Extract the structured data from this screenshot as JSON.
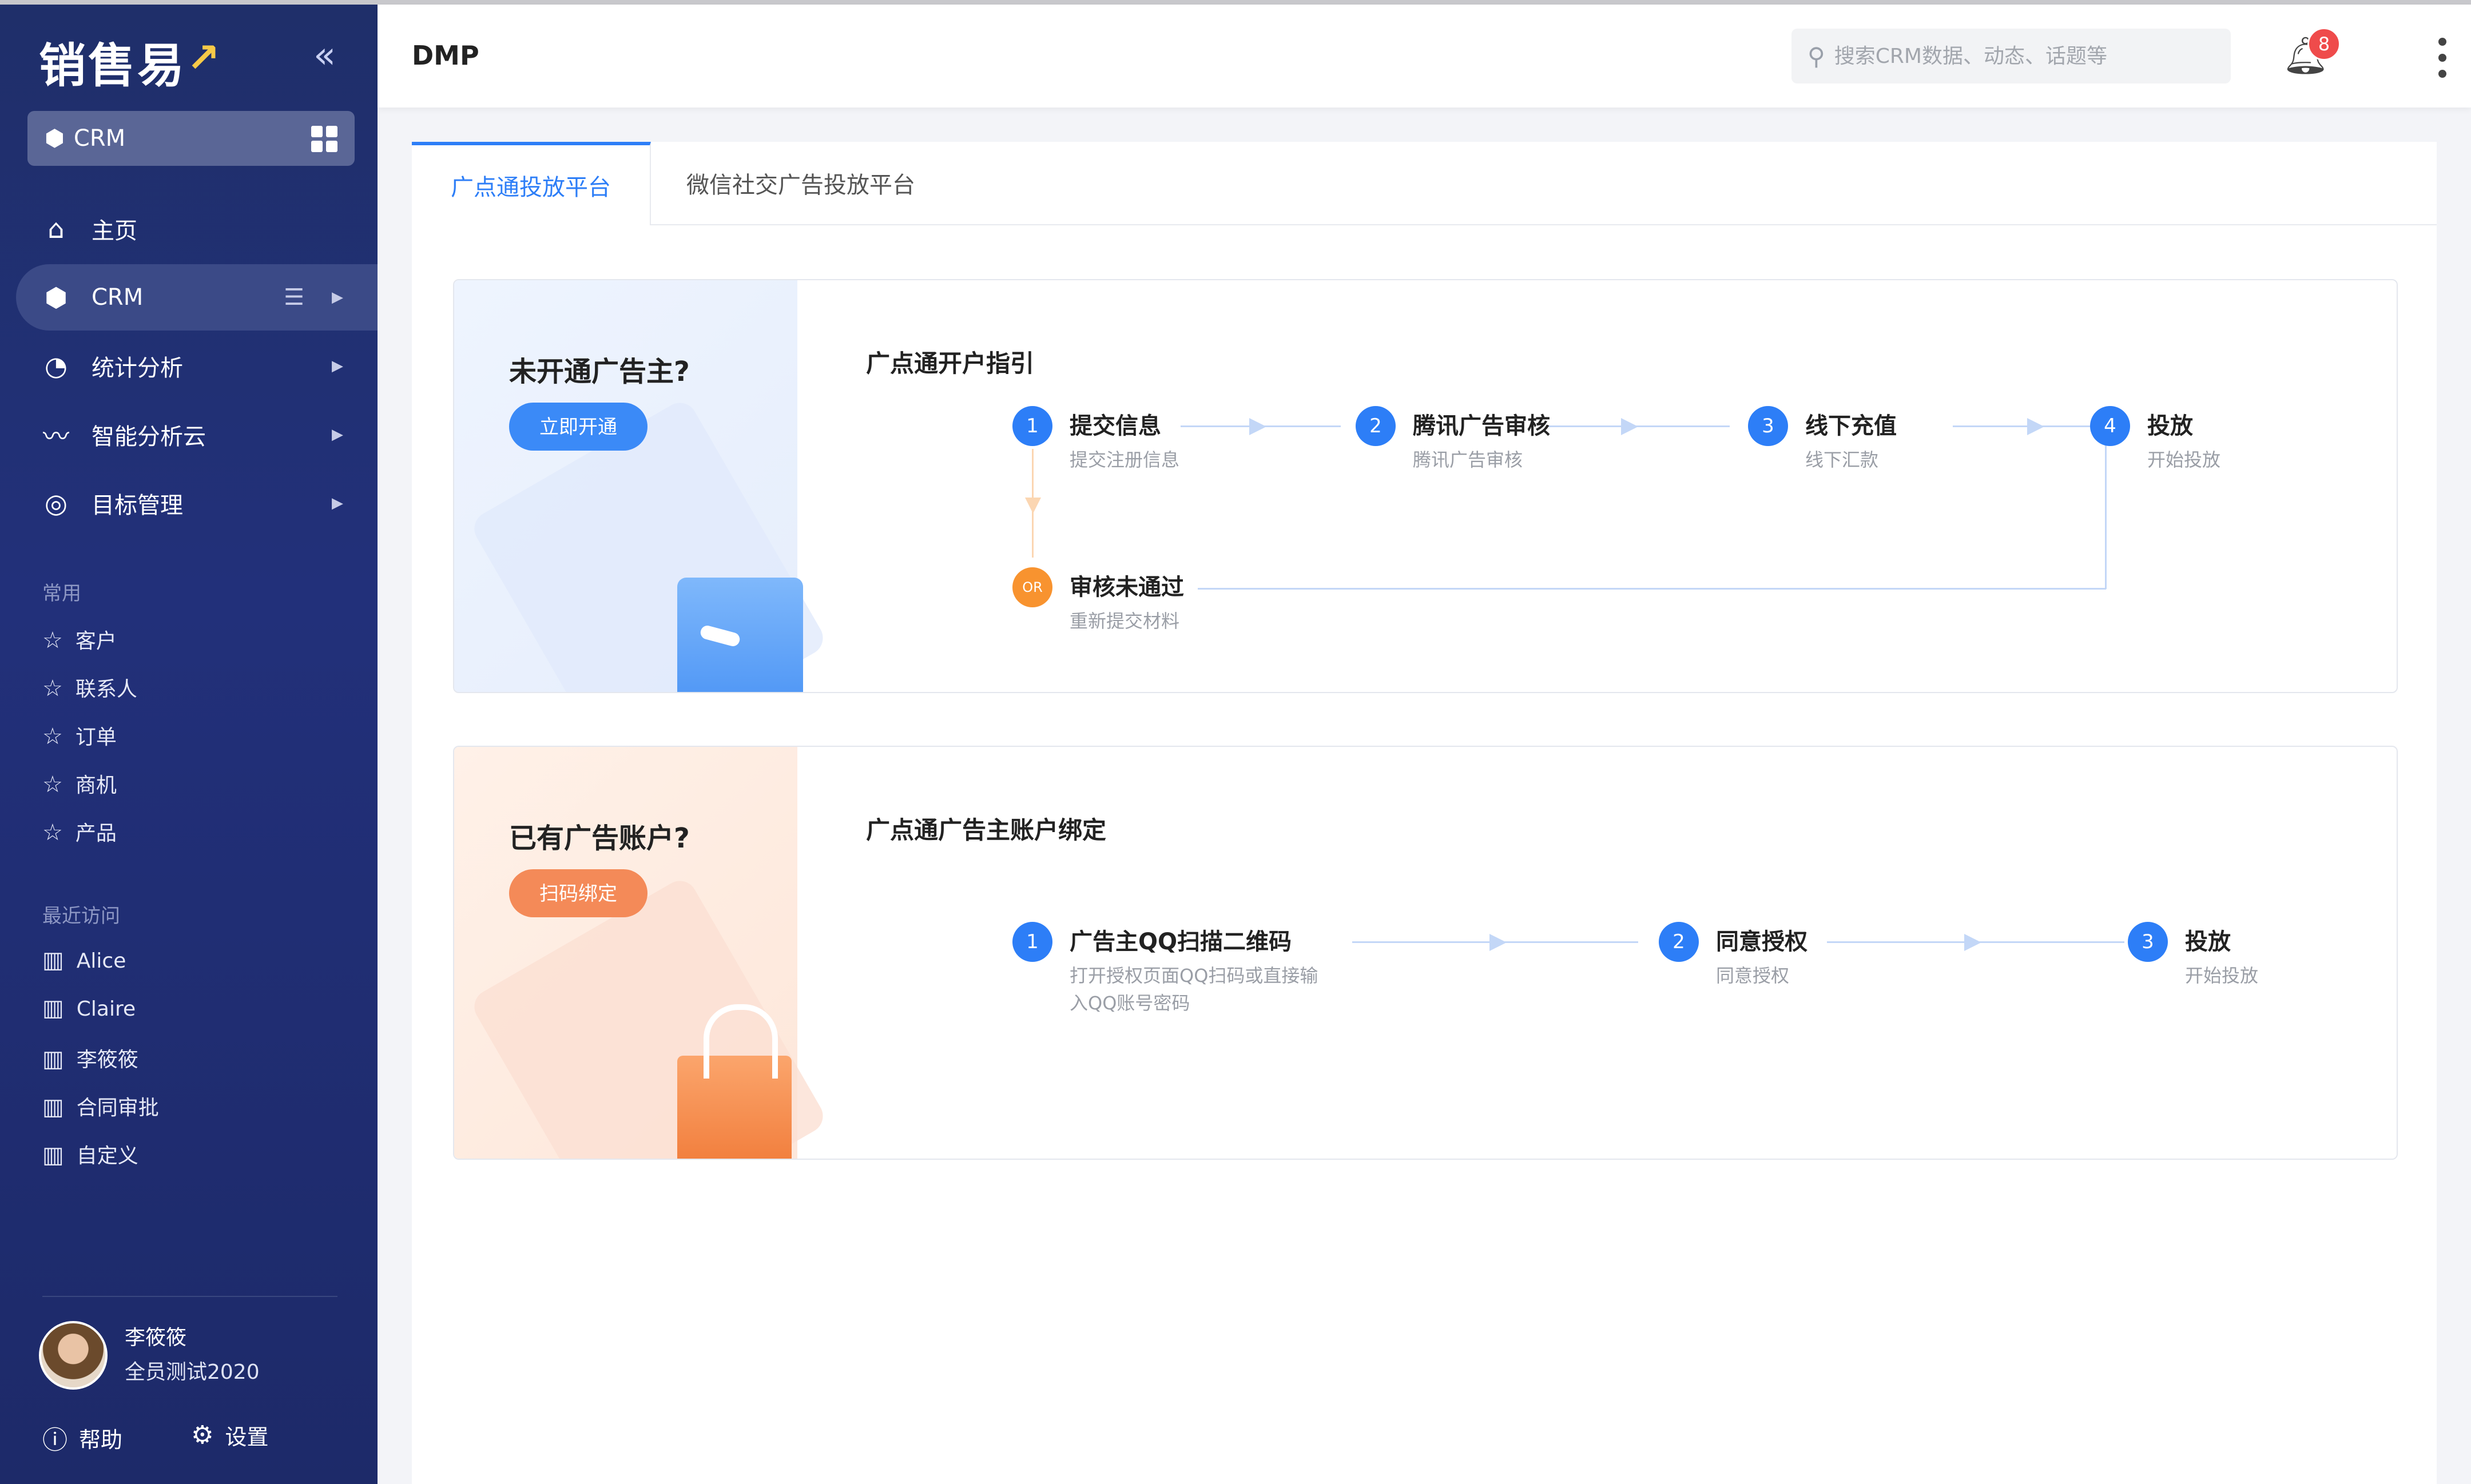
{
  "sidebar": {
    "logo": "销售易",
    "crm_switch": "CRM",
    "nav": [
      {
        "label": "主页",
        "icon": "home-icon"
      },
      {
        "label": "CRM",
        "icon": "crm-cube-icon"
      },
      {
        "label": "统计分析",
        "icon": "pie-chart-icon"
      },
      {
        "label": "智能分析云",
        "icon": "pulse-icon"
      },
      {
        "label": "目标管理",
        "icon": "target-icon"
      }
    ],
    "frequent_title": "常用",
    "frequent": [
      "客户",
      "联系人",
      "订单",
      "商机",
      "产品"
    ],
    "recent_title": "最近访问",
    "recent": [
      "Alice",
      "Claire",
      "李筱筱",
      "合同审批",
      "自定义"
    ],
    "user": {
      "name": "李筱筱",
      "subtitle": "全员测试2020"
    },
    "help": "帮助",
    "settings": "设置"
  },
  "header": {
    "title": "DMP",
    "search_placeholder": "搜索CRM数据、动态、话题等",
    "notification_count": "8"
  },
  "tabs": [
    "广点通投放平台",
    "微信社交广告投放平台"
  ],
  "card1": {
    "question": "未开通广告主?",
    "button": "立即开通",
    "guide_title": "广点通开户指引",
    "steps": [
      {
        "num": "1",
        "title": "提交信息",
        "desc": "提交注册信息"
      },
      {
        "num": "2",
        "title": "腾讯广告审核",
        "desc": "腾讯广告审核"
      },
      {
        "num": "3",
        "title": "线下充值",
        "desc": "线下汇款"
      },
      {
        "num": "4",
        "title": "投放",
        "desc": "开始投放"
      }
    ],
    "alt": {
      "num": "OR",
      "title": "审核未通过",
      "desc": "重新提交材料"
    }
  },
  "card2": {
    "question": "已有广告账户?",
    "button": "扫码绑定",
    "guide_title": "广点通广告主账户绑定",
    "steps": [
      {
        "num": "1",
        "title": "广告主QQ扫描二维码",
        "desc": "打开授权页面QQ扫码或直接输入QQ账号密码"
      },
      {
        "num": "2",
        "title": "同意授权",
        "desc": "同意授权"
      },
      {
        "num": "3",
        "title": "投放",
        "desc": "开始投放"
      }
    ]
  },
  "colors": {
    "accent": "#2d7ef7",
    "sidebar": "#1f2f6a",
    "orange": "#f48a58"
  }
}
